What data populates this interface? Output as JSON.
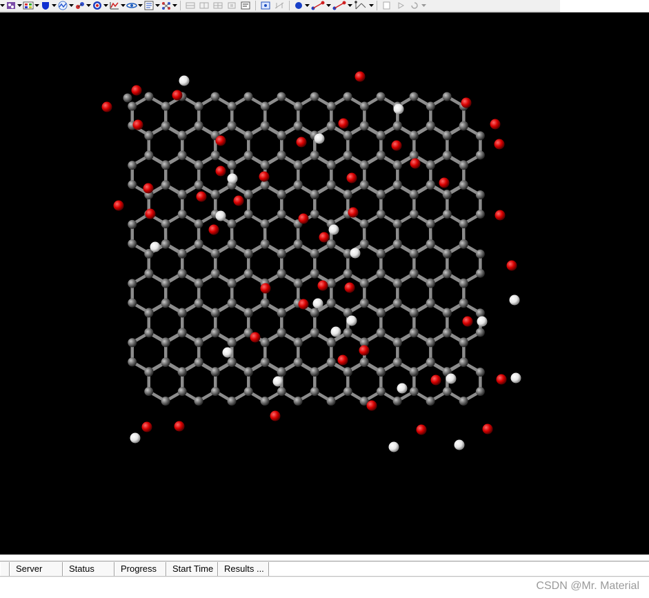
{
  "toolbar": {
    "groups": [
      [
        "molecule-display-icon",
        "color-palette-icon",
        "shield-icon",
        "graph-icon",
        "atom-style-icon",
        "target-icon",
        "chart-icon",
        "orbital-icon",
        "text-icon",
        "lattice-icon"
      ],
      [
        "align-left-icon",
        "align-center-icon",
        "grid-icon",
        "distribute-icon",
        "properties-icon"
      ],
      [
        "select-atoms-icon",
        "measure-icon"
      ],
      [
        "bond-icon",
        "angle-icon",
        "torsion-icon"
      ],
      [
        "new-doc-icon",
        "run-icon",
        "refresh-icon"
      ]
    ]
  },
  "viewport": {
    "background": "#000000",
    "atom_colors": {
      "carbon": "#7a7a7a",
      "oxygen": "#e00000",
      "hydrogen": "#f2f2f2"
    },
    "bond_color": "#8c8c8c"
  },
  "job_table": {
    "columns": [
      "Server",
      "Status",
      "Progress",
      "Start Time",
      "Results ..."
    ]
  },
  "watermark": "CSDN @Mr. Material"
}
